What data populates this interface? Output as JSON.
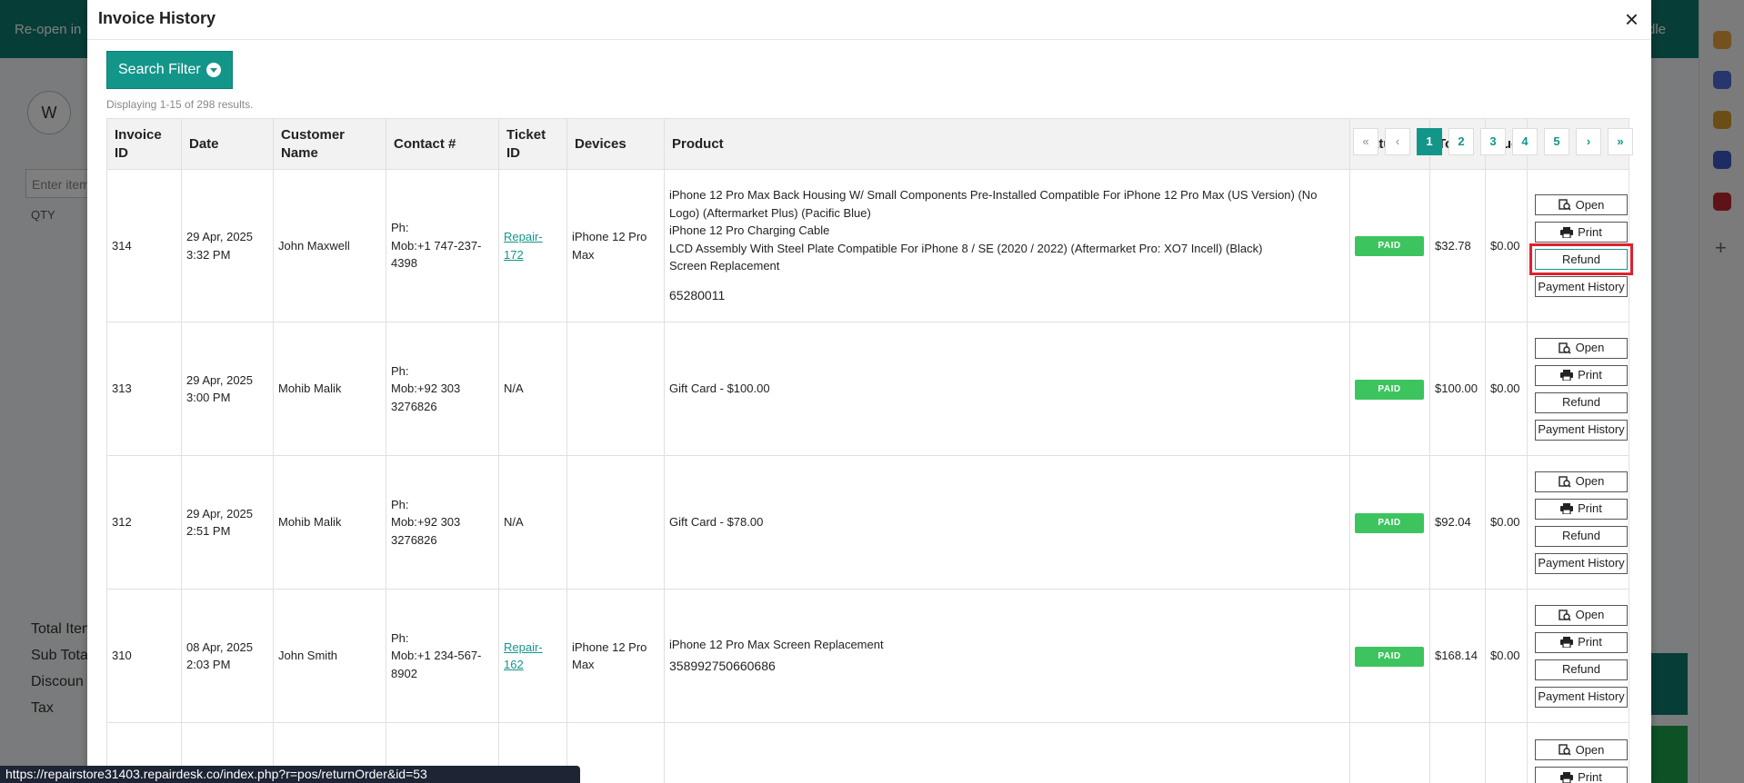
{
  "background": {
    "topbar_left": "Re-open in",
    "topbar_right": "ndle",
    "avatar_letter": "W",
    "item_placeholder": "Enter item",
    "qty_label": "QTY",
    "summary_labels": [
      "Total Item",
      "Sub Tota",
      "Discoun",
      "Tax"
    ]
  },
  "modal": {
    "title": "Invoice History",
    "close_icon": "×",
    "filter_button": "Search Filter",
    "results_text": "Displaying 1-15 of 298 results."
  },
  "pagination": {
    "first": "«",
    "prev": "‹",
    "pages": [
      "1",
      "2",
      "3",
      "4",
      "5"
    ],
    "active_page": "1",
    "next": "›",
    "last": "»"
  },
  "table": {
    "headers": {
      "invoice_id": "Invoice ID",
      "date": "Date",
      "customer": "Customer Name",
      "contact": "Contact #",
      "ticket": "Ticket ID",
      "devices": "Devices",
      "product": "Product",
      "status": "Status",
      "total": "Total",
      "due": "Due"
    },
    "action_labels": {
      "open": "Open",
      "print": "Print",
      "refund": "Refund",
      "payment_history": "Payment History"
    },
    "rows": [
      {
        "invoice_id": "314",
        "date_line1": "29 Apr, 2025",
        "date_line2": "3:32 PM",
        "customer": "John Maxwell",
        "contact_ph": "Ph:",
        "contact_mob": "Mob:+1 747-237-4398",
        "ticket": "Repair- 172",
        "device": "iPhone 12 Pro Max",
        "products": [
          "iPhone 12 Pro Max Back Housing W/ Small Components Pre-Installed Compatible For iPhone 12 Pro Max (US Version) (No Logo) (Aftermarket Plus) (Pacific Blue)",
          "iPhone 12 Pro Charging Cable",
          "LCD Assembly With Steel Plate Compatible For iPhone 8 / SE (2020 / 2022) (Aftermarket Pro: XO7 Incell) (Black)",
          "Screen Replacement"
        ],
        "serial": "65280011",
        "status": "PAID",
        "total": "$32.78",
        "due": "$0.00"
      },
      {
        "invoice_id": "313",
        "date_line1": "29 Apr, 2025",
        "date_line2": "3:00 PM",
        "customer": "Mohib Malik",
        "contact_ph": "Ph:",
        "contact_mob": "Mob:+92 303 3276826",
        "ticket": "N/A",
        "device": "",
        "products": [
          "Gift Card - $100.00"
        ],
        "serial": "",
        "status": "PAID",
        "total": "$100.00",
        "due": "$0.00"
      },
      {
        "invoice_id": "312",
        "date_line1": "29 Apr, 2025",
        "date_line2": "2:51 PM",
        "customer": "Mohib Malik",
        "contact_ph": "Ph:",
        "contact_mob": "Mob:+92 303 3276826",
        "ticket": "N/A",
        "device": "",
        "products": [
          "Gift Card - $78.00"
        ],
        "serial": "",
        "status": "PAID",
        "total": "$92.04",
        "due": "$0.00"
      },
      {
        "invoice_id": "310",
        "date_line1": "08 Apr, 2025",
        "date_line2": "2:03 PM",
        "customer": "John Smith",
        "contact_ph": "Ph:",
        "contact_mob": "Mob:+1 234-567-8902",
        "ticket": "Repair- 162",
        "device": "iPhone 12 Pro Max",
        "products": [
          "iPhone 12 Pro Max Screen Replacement"
        ],
        "serial": "358992750660686",
        "status": "PAID",
        "total": "$168.14",
        "due": "$0.00"
      }
    ]
  },
  "status_bar": {
    "url": "https://repairstore31403.repairdesk.co/index.php?r=pos/returnOrder&id=53"
  },
  "colors": {
    "accent": "#13968a",
    "paid": "#3ec45f",
    "highlight": "#e0202e",
    "topbar": "#0f7a6e"
  }
}
